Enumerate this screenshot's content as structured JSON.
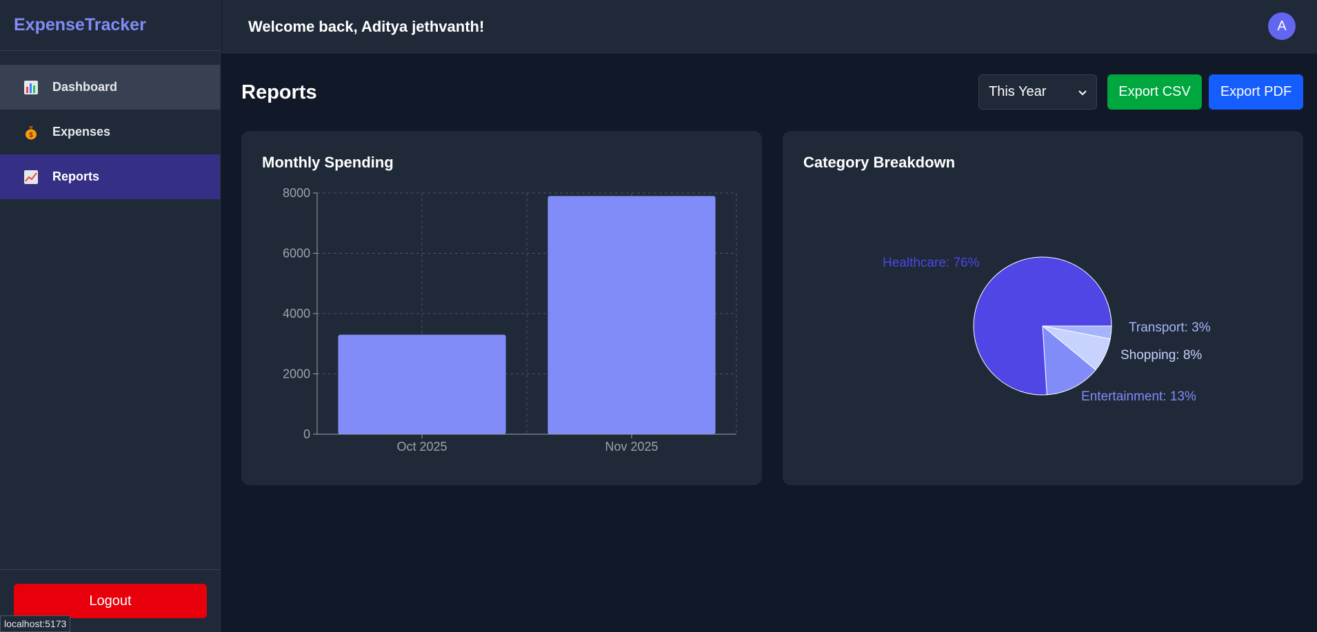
{
  "brand": "ExpenseTracker",
  "nav": [
    {
      "label": "Dashboard",
      "icon": "bar-chart-icon"
    },
    {
      "label": "Expenses",
      "icon": "money-bag-icon"
    },
    {
      "label": "Reports",
      "icon": "trend-chart-icon"
    }
  ],
  "logout_label": "Logout",
  "status_url": "localhost:5173",
  "header": {
    "welcome": "Welcome back, Aditya jethvanth!",
    "avatar_initial": "A"
  },
  "page": {
    "title": "Reports",
    "period": "This Year",
    "export_csv": "Export CSV",
    "export_pdf": "Export PDF"
  },
  "colors": {
    "accent": "#818cf8",
    "active_nav": "#362f86",
    "csv": "#00a63e",
    "pdf": "#155dfc",
    "logout": "#e7000b"
  },
  "cards": {
    "monthly_title": "Monthly Spending",
    "category_title": "Category Breakdown"
  },
  "chart_data": [
    {
      "type": "bar",
      "title": "Monthly Spending",
      "categories": [
        "Oct 2025",
        "Nov 2025"
      ],
      "values": [
        3300,
        7900
      ],
      "ylim": [
        0,
        8000
      ],
      "yticks": [
        0,
        2000,
        4000,
        6000,
        8000
      ],
      "grid": true,
      "color": "#818cf8"
    },
    {
      "type": "pie",
      "title": "Category Breakdown",
      "slices": [
        {
          "label": "Healthcare: 76%",
          "value": 76,
          "color": "#4f46e5"
        },
        {
          "label": "Entertainment: 13%",
          "value": 13,
          "color": "#818cf8"
        },
        {
          "label": "Shopping: 8%",
          "value": 8,
          "color": "#c7d2fe"
        },
        {
          "label": "Transport: 3%",
          "value": 3,
          "color": "#a5b4fc"
        }
      ]
    }
  ]
}
